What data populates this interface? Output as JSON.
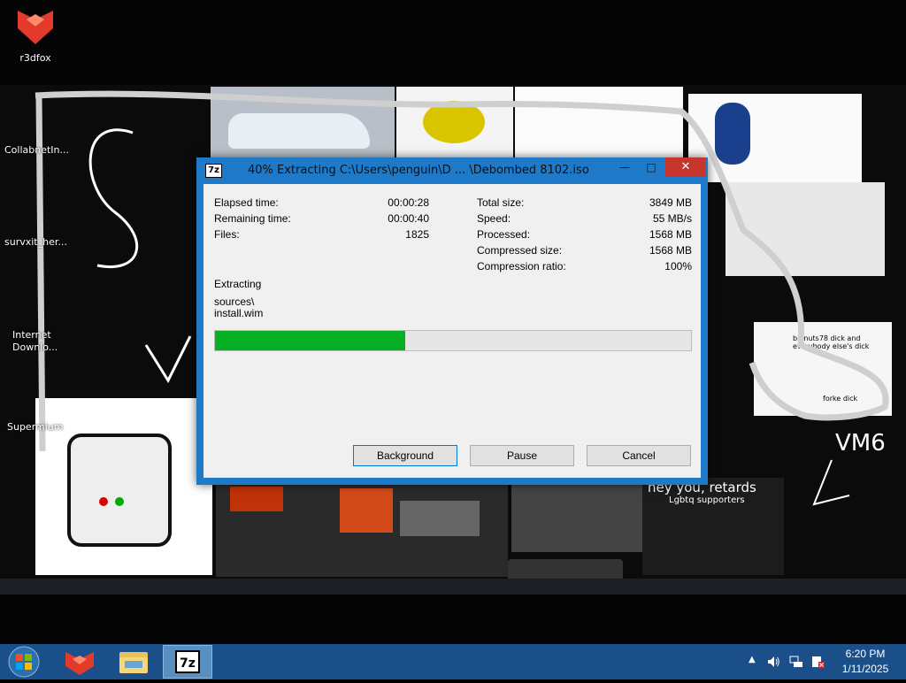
{
  "desktop": {
    "icons": [
      {
        "label": "r3dfox"
      }
    ],
    "side_labels": {
      "collabnet": "CollabnetIn...",
      "survxit": "survxit_her...",
      "idm": "Internet\nDownlo...",
      "supermium": "Supermium"
    },
    "wallpaper_text": {
      "vm6": "VM6",
      "meme": "hey you, retards",
      "meme2": "Lgbtq supporters",
      "hint": "bignuts78 dick and everybody else's dick",
      "forks": "forke dick"
    }
  },
  "dialog": {
    "icon_text": "7z",
    "title": "40% Extracting C:\\Users\\penguin\\D ... \\Debombed 8102.iso",
    "left_stats": [
      {
        "label": "Elapsed time:",
        "value": "00:00:28"
      },
      {
        "label": "Remaining time:",
        "value": "00:00:40"
      },
      {
        "label": "Files:",
        "value": "1825"
      }
    ],
    "right_stats": [
      {
        "label": "Total size:",
        "value": "3849 MB"
      },
      {
        "label": "Speed:",
        "value": "55 MB/s"
      },
      {
        "label": "Processed:",
        "value": "1568 MB"
      },
      {
        "label": "Compressed size:",
        "value": "1568 MB"
      },
      {
        "label": "Compression ratio:",
        "value": "100%"
      }
    ],
    "status": "Extracting",
    "path_line1": "sources\\",
    "path_line2": "install.wim",
    "progress_percent": 40,
    "buttons": {
      "background": "Background",
      "pause": "Pause",
      "cancel": "Cancel"
    },
    "accent_color": "#1e79c8",
    "progress_color": "#06b025"
  },
  "taskbar": {
    "items": [
      {
        "name": "r3dfox",
        "icon": "r3dfox-icon"
      },
      {
        "name": "File Explorer",
        "icon": "folder-icon"
      },
      {
        "name": "7-Zip",
        "icon": "7zip-icon",
        "active": true
      }
    ],
    "tray": {
      "time": "6:20 PM",
      "date": "1/11/2025"
    }
  }
}
